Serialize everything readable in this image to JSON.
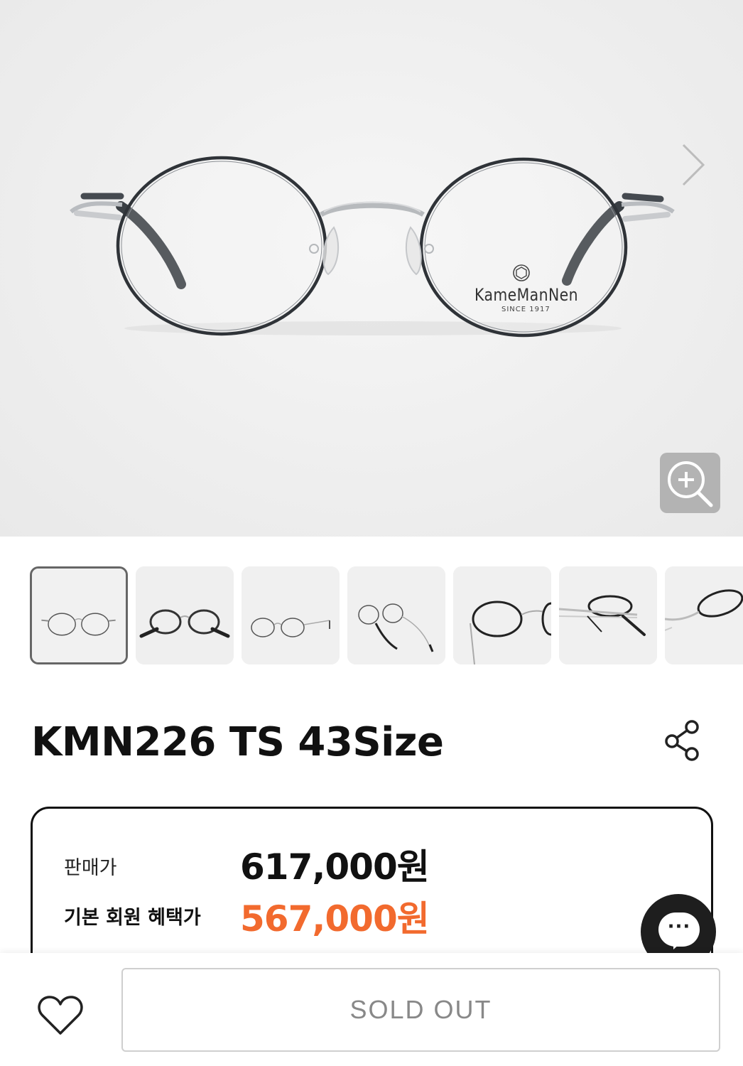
{
  "hero": {
    "brand_logo_text": "KameManNen",
    "brand_logo_subtext": "SINCE 1917",
    "next_icon": "chevron-right-icon",
    "zoom_icon": "zoom-in-icon"
  },
  "thumbnails": [
    {
      "view": "front",
      "selected": true
    },
    {
      "view": "front-dark",
      "selected": false
    },
    {
      "view": "front-open-temples",
      "selected": false
    },
    {
      "view": "angled-left",
      "selected": false
    },
    {
      "view": "side-right",
      "selected": false
    },
    {
      "view": "top-folded",
      "selected": false
    },
    {
      "view": "side-closeup",
      "selected": false
    }
  ],
  "product": {
    "title": "KMN226 TS 43Size",
    "share_icon": "share-icon"
  },
  "pricing": {
    "sale_price_label": "판매가",
    "sale_price": "617,000원",
    "member_price_label": "기본 회원 혜택가",
    "member_price": "567,000원",
    "member_price_color": "#f26a2e"
  },
  "chat": {
    "icon": "chat-bubble-icon",
    "dots": "···"
  },
  "bottom": {
    "wishlist_icon": "heart-icon",
    "soldout_label": "SOLD OUT"
  }
}
